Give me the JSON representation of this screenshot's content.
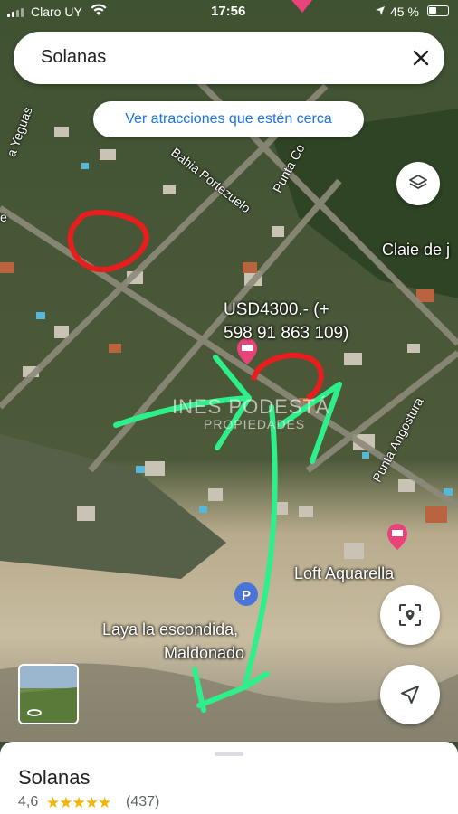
{
  "status_bar": {
    "carrier": "Claro UY",
    "time": "17:56",
    "battery": "45 %"
  },
  "search": {
    "query": "Solanas"
  },
  "nearby_chip": {
    "label": "Ver atracciones que estén cerca"
  },
  "map": {
    "roads": [
      "Bahia Portezuelo",
      "Punta Co",
      "Punta Angostura",
      "a Yeguas",
      "e"
    ],
    "places": [
      "Claie de j",
      "Loft Aquarella",
      "Laya la escondida,",
      "Maldonado"
    ],
    "annotation": [
      "USD4300.- (+",
      "598 91 863 109)"
    ],
    "watermark": [
      "INES PODESTÁ",
      "PROPIEDADES"
    ]
  },
  "place_sheet": {
    "title": "Solanas",
    "rating": "4,6",
    "stars": "★★★★★",
    "review_count": "(437)"
  },
  "colors": {
    "accent": "#1a73e8",
    "star": "#f5b400",
    "pin": "#e8437a",
    "red_mark": "#e81e1e",
    "green_arrow": "#2ef08a"
  }
}
